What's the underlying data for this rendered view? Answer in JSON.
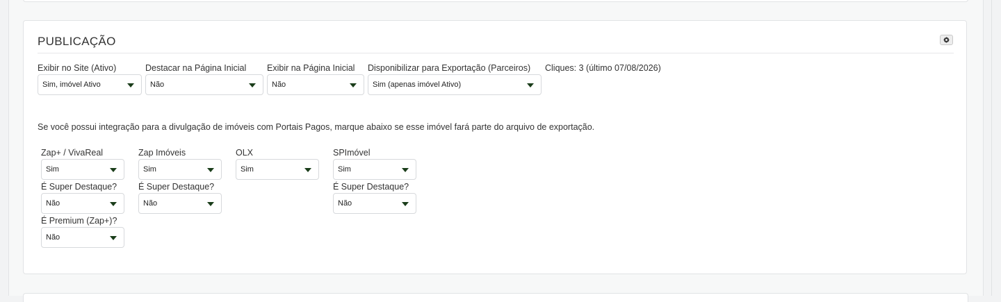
{
  "section": {
    "title": "PUBLICAÇÃO",
    "settings_icon": "gear-icon"
  },
  "top_fields": [
    {
      "label": "Exibir no Site (Ativo)",
      "value": "Sim, imóvel Ativo"
    },
    {
      "label": "Destacar na Página Inicial",
      "value": "Não"
    },
    {
      "label": "Exibir na Página Inicial",
      "value": "Não"
    },
    {
      "label": "Disponibilizar para Exportação (Parceiros)",
      "value": "Sim (apenas imóvel Ativo)"
    }
  ],
  "clicks_text": "Cliques: 3 (último 07/08/2026)",
  "info_text": "Se você possui integração para a divulgação de imóveis com Portais Pagos, marque abaixo se esse imóvel fará parte do arquivo de exportação.",
  "portals": {
    "zap_vivareal": {
      "label": "Zap+ / VivaReal",
      "value": "Sim",
      "super_label": "É Super Destaque?",
      "super_value": "Não",
      "premium_label": "É Premium (Zap+)?",
      "premium_value": "Não"
    },
    "zap_imoveis": {
      "label": "Zap Imóveis",
      "value": "Sim",
      "super_label": "É Super Destaque?",
      "super_value": "Não"
    },
    "olx": {
      "label": "OLX",
      "value": "Sim"
    },
    "spimovel": {
      "label": "SPImóvel",
      "value": "Sim",
      "super_label": "É Super Destaque?",
      "super_value": "Não"
    }
  },
  "colors": {
    "caret": "#1a3d1a",
    "panel_border": "#e1e3e5",
    "background": "#f2f3f4"
  }
}
